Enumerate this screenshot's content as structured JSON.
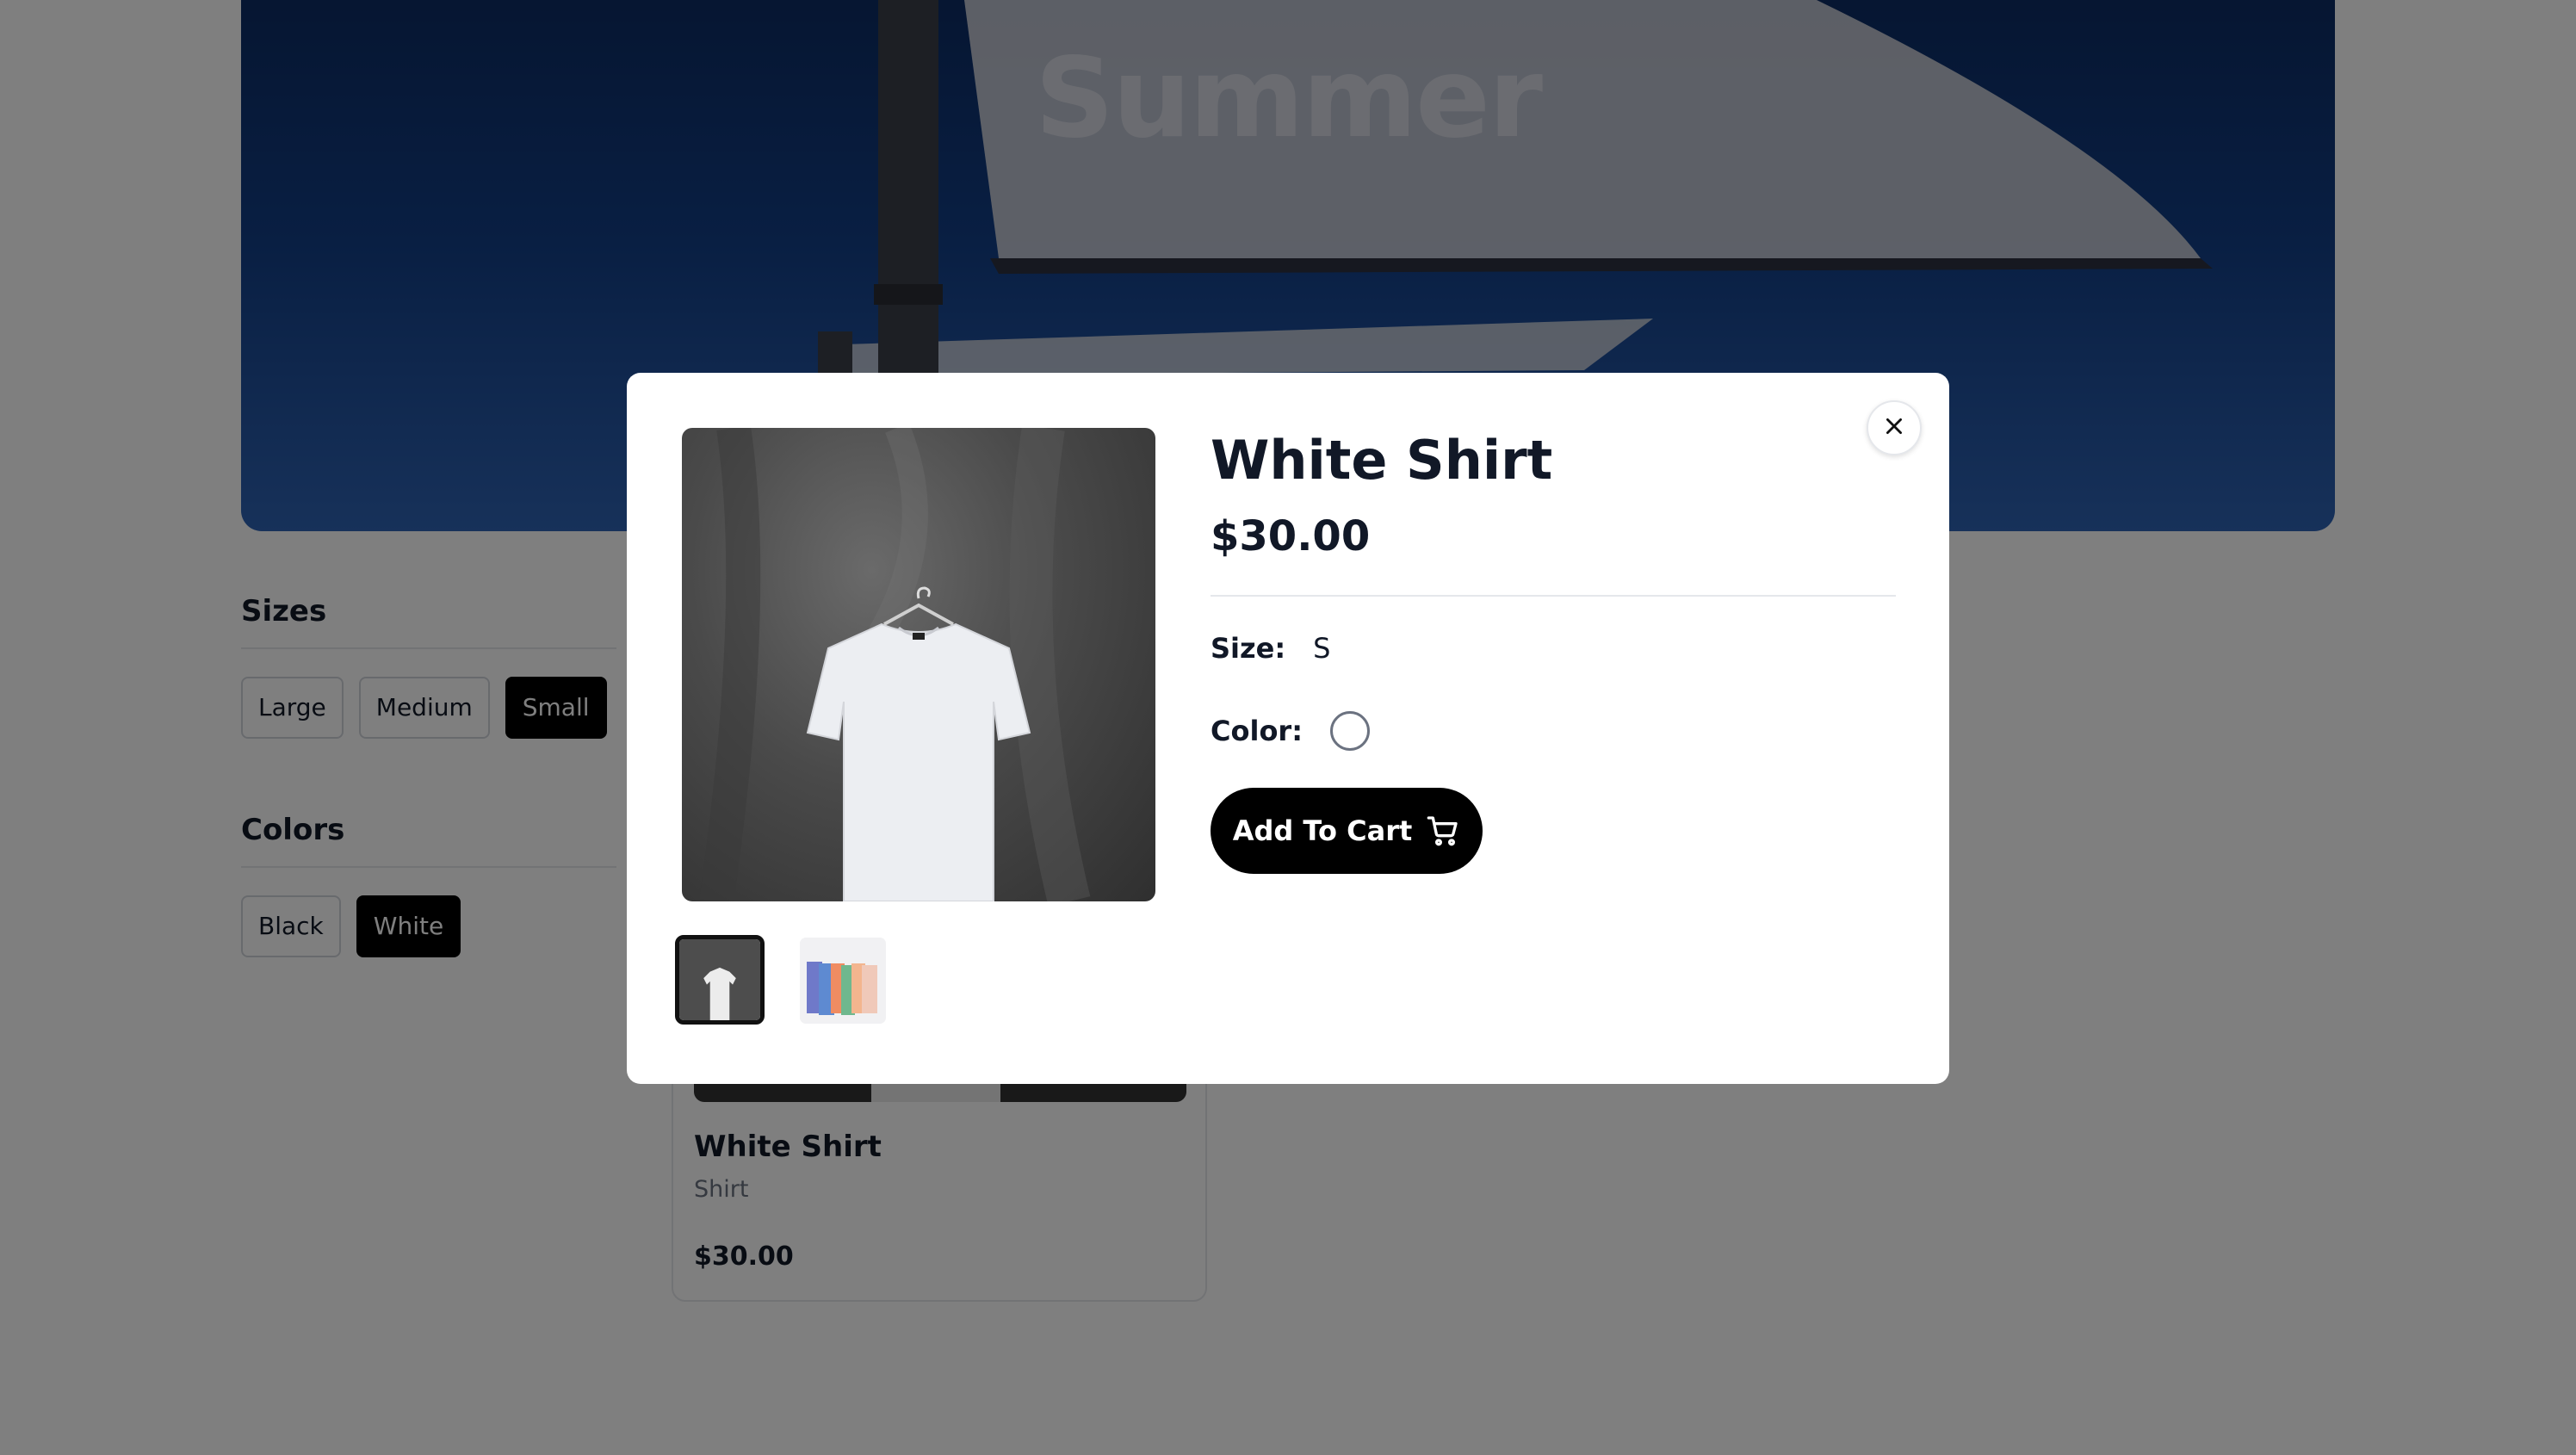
{
  "hero": {
    "title": "Summer"
  },
  "filters": {
    "sizes": {
      "title": "Sizes",
      "options": [
        "Large",
        "Medium",
        "Small"
      ],
      "selected": "Small"
    },
    "colors": {
      "title": "Colors",
      "options": [
        "Black",
        "White"
      ],
      "selected": "White"
    }
  },
  "product_card": {
    "name": "White Shirt",
    "category": "Shirt",
    "price": "$30.00"
  },
  "modal": {
    "title": "White Shirt",
    "price": "$30.00",
    "size_label": "Size:",
    "size_value": "S",
    "color_label": "Color:",
    "color_value_hex": "#ffffff",
    "add_to_cart_label": "Add To Cart",
    "close_icon": "close-icon",
    "cart_icon": "cart-icon",
    "thumbnails": [
      "white-shirt-on-hanger",
      "colored-shirts-on-rack"
    ],
    "active_thumbnail": 0
  }
}
